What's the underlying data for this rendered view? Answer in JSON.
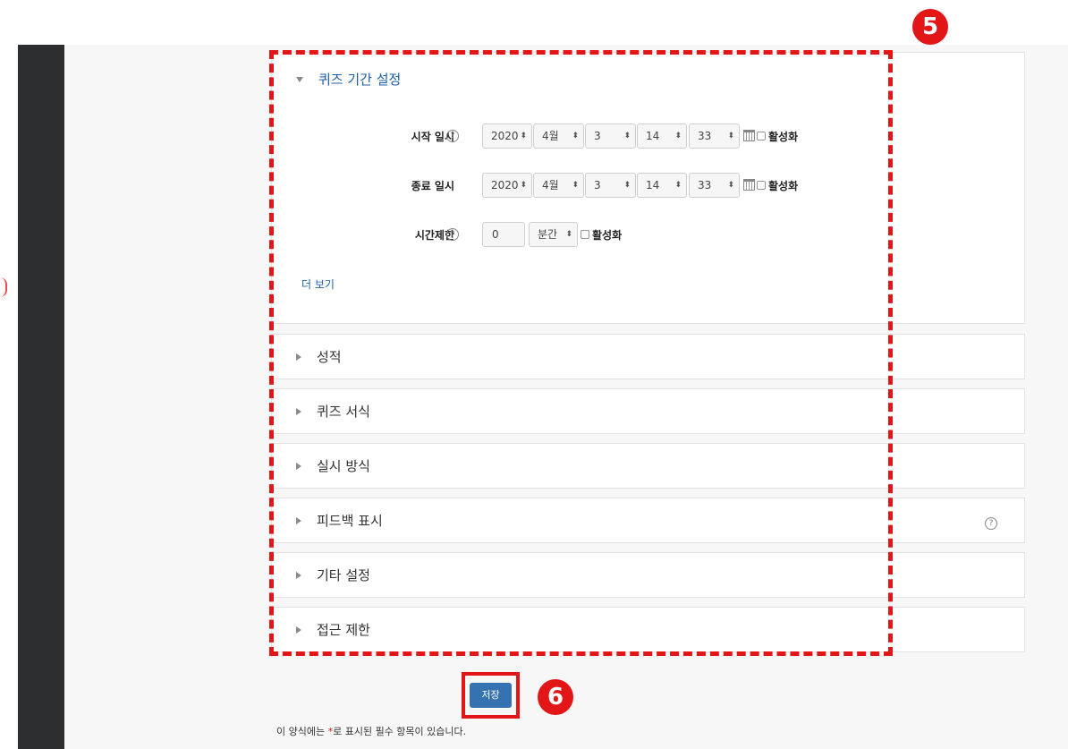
{
  "sections": {
    "expanded": {
      "title": "퀴즈 기간 설정",
      "more_link": "더 보기"
    },
    "collapsed": [
      {
        "title": "성적"
      },
      {
        "title": "퀴즈 서식"
      },
      {
        "title": "실시 방식"
      },
      {
        "title": "피드백 표시"
      },
      {
        "title": "기타 설정"
      },
      {
        "title": "접근 제한"
      }
    ]
  },
  "fields": {
    "open": {
      "label": "시작 일시",
      "year": "2020",
      "month": "4월",
      "day": "3",
      "hour": "14",
      "minute": "33",
      "enable": "활성화"
    },
    "close": {
      "label": "종료 일시",
      "year": "2020",
      "month": "4월",
      "day": "3",
      "hour": "14",
      "minute": "33",
      "enable": "활성화"
    },
    "timelimit": {
      "label": "시간제한",
      "value": "0",
      "unit": "분간",
      "enable": "활성화"
    }
  },
  "icons": {
    "help": "help-circle-icon",
    "calendar": "calendar-icon",
    "expand": "chevron-right-icon",
    "collapse": "chevron-down-icon"
  },
  "footer": {
    "save_label": "저장",
    "note_before": "이 양식에는 ",
    "note_star": "*",
    "note_after": "로 표시된 필수 항목이 있습니다."
  },
  "annotations": {
    "step5": "5",
    "step6": "6"
  },
  "colors": {
    "accent": "#3572b0",
    "link": "#1d5fa5",
    "annotation": "#e21616",
    "sidebar": "#2c2e30"
  }
}
